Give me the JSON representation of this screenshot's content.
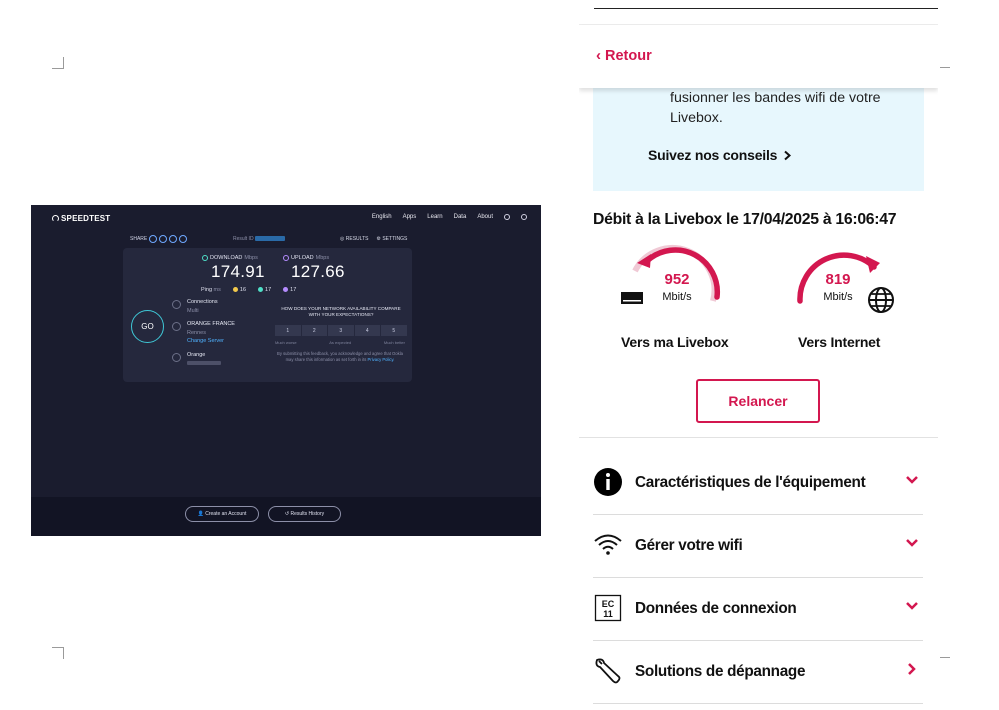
{
  "speedtest": {
    "logo": "SPEEDTEST",
    "nav": [
      "English",
      "Apps",
      "Learn",
      "Data",
      "About"
    ],
    "share_label": "SHARE",
    "result_label": "Result ID",
    "results_label": "RESULTS",
    "settings_label": "SETTINGS",
    "download_label": "DOWNLOAD",
    "upload_label": "UPLOAD",
    "unit_mbps": "Mbps",
    "download_value": "174.91",
    "upload_value": "127.66",
    "ping_label": "Ping",
    "ping_unit": "ms",
    "ping_idle": "16",
    "ping_down": "17",
    "ping_up": "17",
    "go_label": "GO",
    "connections_label": "Connections",
    "connections_value": "Multi",
    "isp_name": "ORANGE FRANCE",
    "isp_city": "Rennes",
    "change_server": "Change Server",
    "user_isp": "Orange",
    "question": "HOW DOES YOUR NETWORK AVAILABILITY COMPARE WITH YOUR EXPECTATIONS?",
    "scale": [
      "1",
      "2",
      "3",
      "4",
      "5"
    ],
    "scale_low": "Much worse",
    "scale_mid": "As expected",
    "scale_high": "Much better",
    "disclaimer": "By submitting this feedback, you acknowledge and agree that Ookla may share this information as set forth in its",
    "privacy_link": "Privacy Policy.",
    "create_account": "Create an Account",
    "results_history": "Results History"
  },
  "mobile": {
    "back_label": "Retour",
    "banner_text": "fusionner les bandes wifi de votre Livebox.",
    "banner_cta": "Suivez nos conseils",
    "debit_title": "Débit à la Livebox le 17/04/2025 à 16:06:47",
    "gauge_down": {
      "value": "952",
      "unit": "Mbit/s",
      "label": "Vers ma Livebox"
    },
    "gauge_up": {
      "value": "819",
      "unit": "Mbit/s",
      "label": "Vers Internet"
    },
    "relaunch_label": "Relancer",
    "menu": [
      {
        "label": "Caractéristiques de l'équipement",
        "icon": "info-icon"
      },
      {
        "label": "Gérer votre wifi",
        "icon": "wifi-icon"
      },
      {
        "label": "Données de connexion",
        "icon": "ec-code-icon"
      },
      {
        "label": "Solutions de dépannage",
        "icon": "wrench-icon"
      }
    ],
    "accent_color": "#d3174f"
  }
}
